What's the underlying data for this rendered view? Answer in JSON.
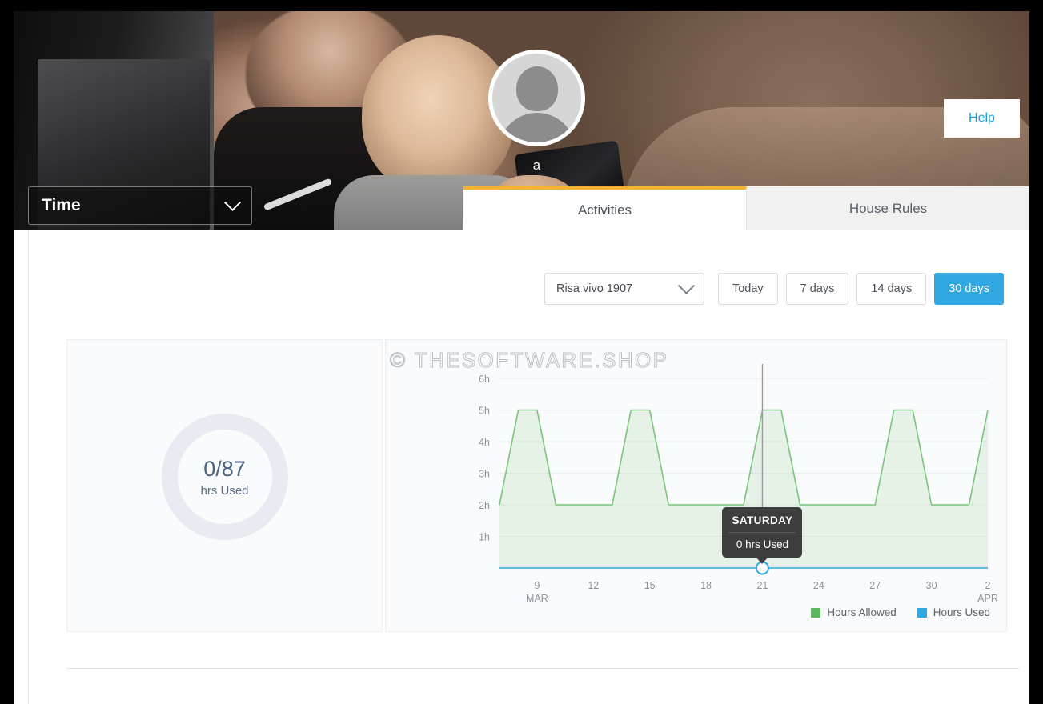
{
  "header": {
    "avatar_name": "a",
    "avatar_icon": "user-avatar-icon",
    "help_label": "Help"
  },
  "time_select": {
    "label": "Time",
    "chevron_icon": "chevron-down-icon"
  },
  "tabs": [
    {
      "label": "Activities",
      "active": true
    },
    {
      "label": "House Rules",
      "active": false
    }
  ],
  "filters": {
    "device": {
      "selected": "Risa vivo 1907",
      "chevron_icon": "chevron-down-icon"
    },
    "ranges": [
      {
        "label": "Today",
        "active": false
      },
      {
        "label": "7 days",
        "active": false
      },
      {
        "label": "14 days",
        "active": false
      },
      {
        "label": "30 days",
        "active": true
      }
    ]
  },
  "summary": {
    "value": "0/87",
    "label": "hrs Used"
  },
  "watermark": "© THESOFTWARE.SHOP",
  "tooltip": {
    "title": "SATURDAY",
    "value": "0 hrs Used"
  },
  "colors": {
    "accent_blue": "#31a8e0",
    "tab_active_border": "#f5b335",
    "allowed_green": "#5cb85c",
    "used_blue": "#31a8e0",
    "tooltip_bg": "#3d3d3d",
    "donut_ring": "#e8ecf2"
  },
  "chart_data": {
    "type": "area",
    "title": "",
    "xlabel": "",
    "ylabel": "",
    "ylim": [
      0,
      6
    ],
    "grid": true,
    "legend_position": "bottom-right",
    "y_ticks": [
      "6h",
      "5h",
      "4h",
      "3h",
      "2h",
      "1h"
    ],
    "y_tick_values": [
      6,
      5,
      4,
      3,
      2,
      1
    ],
    "x_ticks": [
      "9",
      "12",
      "15",
      "18",
      "21",
      "24",
      "27",
      "30",
      "2"
    ],
    "x_tick_sublabels": [
      "MAR",
      "",
      "",
      "",
      "",
      "",
      "",
      "",
      "APR"
    ],
    "x_range_days": [
      7,
      33
    ],
    "series": [
      {
        "name": "Hours Allowed",
        "color": "#5cb85c",
        "fill": "rgba(92,184,92,0.12)",
        "x": [
          7,
          8,
          9,
          10,
          11,
          12,
          13,
          14,
          15,
          16,
          17,
          18,
          19,
          20,
          21,
          22,
          23,
          24,
          25,
          26,
          27,
          28,
          29,
          30,
          31,
          32,
          33
        ],
        "values": [
          2,
          5,
          5,
          2,
          2,
          2,
          2,
          5,
          5,
          2,
          2,
          2,
          2,
          2,
          5,
          5,
          2,
          2,
          2,
          2,
          2,
          5,
          5,
          2,
          2,
          2,
          5
        ]
      },
      {
        "name": "Hours Used",
        "color": "#31a8e0",
        "fill": "none",
        "x": [
          7,
          8,
          9,
          10,
          11,
          12,
          13,
          14,
          15,
          16,
          17,
          18,
          19,
          20,
          21,
          22,
          23,
          24,
          25,
          26,
          27,
          28,
          29,
          30,
          31,
          32,
          33
        ],
        "values": [
          0,
          0,
          0,
          0,
          0,
          0,
          0,
          0,
          0,
          0,
          0,
          0,
          0,
          0,
          0,
          0,
          0,
          0,
          0,
          0,
          0,
          0,
          0,
          0,
          0,
          0,
          0
        ]
      }
    ],
    "hover_point": {
      "x": 21,
      "y": 0,
      "label": "SATURDAY",
      "value": "0 hrs Used"
    },
    "legend": [
      {
        "label": "Hours Allowed",
        "color": "#5cb85c"
      },
      {
        "label": "Hours Used",
        "color": "#31a8e0"
      }
    ]
  }
}
